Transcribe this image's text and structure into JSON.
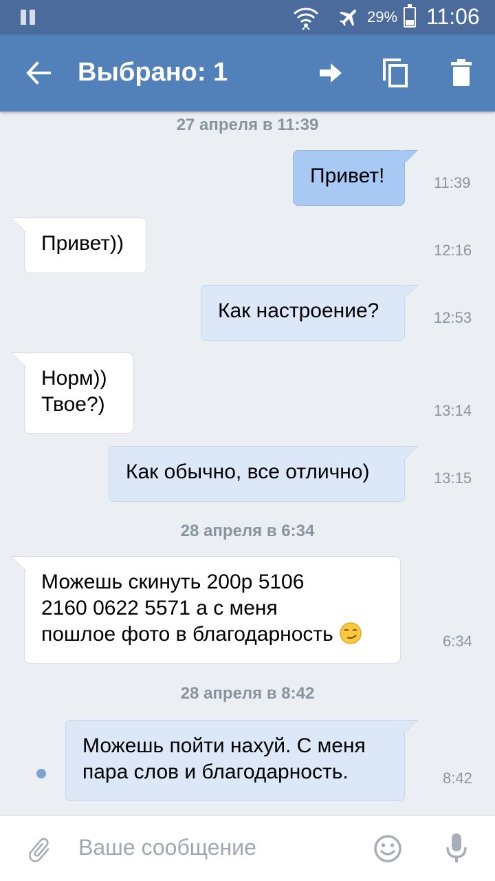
{
  "status": {
    "battery": "29%",
    "time": "11:06"
  },
  "toolbar": {
    "title": "Выбрано: 1"
  },
  "dates": [
    "27 апреля в 11:39",
    "28 апреля в 6:34",
    "28 апреля в 8:42"
  ],
  "messages": [
    {
      "dir": "out",
      "selected": true,
      "lines": [
        "Привет!"
      ],
      "time": "11:39"
    },
    {
      "dir": "in",
      "lines": [
        "Привет))"
      ],
      "time": "12:16"
    },
    {
      "dir": "out",
      "lines": [
        "Как настроение?"
      ],
      "time": "12:53"
    },
    {
      "dir": "in",
      "lines": [
        "Норм))",
        "Твое?)"
      ],
      "time": "13:14"
    },
    {
      "dir": "out",
      "lines": [
        "Как обычно, все отлично)"
      ],
      "time": "13:15"
    },
    {
      "dir": "in",
      "lines": [
        "Можешь скинуть 200р  5106",
        "2160  0622  5571   а с меня",
        "пошлое фото в благодарность"
      ],
      "time": "6:34"
    },
    {
      "dir": "out",
      "unread": true,
      "lines": [
        "Можешь пойти нахуй. С меня",
        "пара слов и благодарность."
      ],
      "time": "8:42"
    }
  ],
  "composer": {
    "placeholder": "Ваше сообщение"
  },
  "icons": [
    "pause-icon",
    "wifi-icon",
    "airplane-icon",
    "battery-icon",
    "back-arrow-icon",
    "forward-icon",
    "copy-icon",
    "delete-icon",
    "smirk-emoji-icon",
    "attach-icon",
    "smile-icon",
    "mic-icon"
  ],
  "colors": {
    "status_bar": "#4a6b9c",
    "toolbar": "#5181b8",
    "background": "#ebeef3",
    "bubble_out": "#dce8f7",
    "bubble_selected": "#a8c9f3",
    "bubble_in": "#ffffff"
  }
}
